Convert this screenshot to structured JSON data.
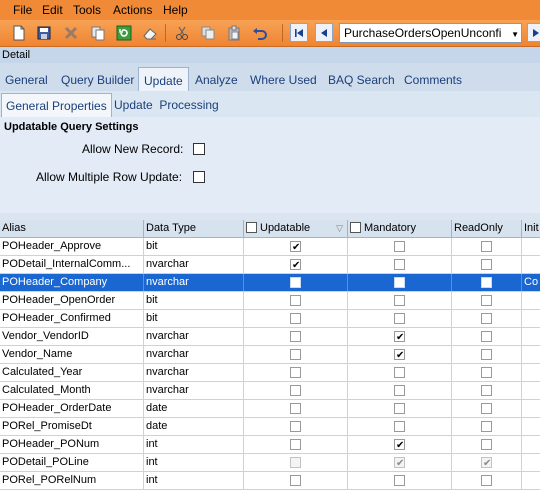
{
  "menu": {
    "items": [
      "File",
      "Edit",
      "Tools",
      "Actions",
      "Help"
    ]
  },
  "toolbar": {
    "icons": [
      "new-icon",
      "save-icon",
      "delete-icon",
      "copy-icon",
      "refresh-icon",
      "clear-icon",
      "cut-icon",
      "copy-clip-icon",
      "paste-icon",
      "undo-icon"
    ],
    "query_selector_value": "PurchaseOrdersOpenUnconfi"
  },
  "detail_label": "Detail",
  "tabs": [
    "General",
    "Query Builder",
    "Update",
    "Analyze",
    "Where Used",
    "BAQ Search",
    "Comments"
  ],
  "active_tab": "Update",
  "subtabs": [
    "General Properties",
    "Update  Processing"
  ],
  "settings": {
    "title": "Updatable Query Settings",
    "allow_new_record": "Allow New Record:",
    "allow_multiple": "Allow Multiple Row Update:"
  },
  "grid": {
    "columns": [
      "Alias",
      "Data Type",
      "Updatable",
      "Mandatory",
      "ReadOnly",
      "Init"
    ],
    "rows": [
      {
        "alias": "POHeader_Approve",
        "type": "bit",
        "upd": true,
        "mand": false,
        "ro": false,
        "init": ""
      },
      {
        "alias": "PODetail_InternalComm...",
        "type": "nvarchar",
        "upd": true,
        "mand": false,
        "ro": false,
        "init": ""
      },
      {
        "alias": "POHeader_Company",
        "type": "nvarchar",
        "upd": false,
        "mand": false,
        "ro": false,
        "init": "Co",
        "selected": true
      },
      {
        "alias": "POHeader_OpenOrder",
        "type": "bit",
        "upd": false,
        "mand": false,
        "ro": false,
        "init": ""
      },
      {
        "alias": "POHeader_Confirmed",
        "type": "bit",
        "upd": false,
        "mand": false,
        "ro": false,
        "init": ""
      },
      {
        "alias": "Vendor_VendorID",
        "type": "nvarchar",
        "upd": false,
        "mand": true,
        "ro": false,
        "init": ""
      },
      {
        "alias": "Vendor_Name",
        "type": "nvarchar",
        "upd": false,
        "mand": true,
        "ro": false,
        "init": ""
      },
      {
        "alias": "Calculated_Year",
        "type": "nvarchar",
        "upd": false,
        "mand": false,
        "ro": false,
        "init": ""
      },
      {
        "alias": "Calculated_Month",
        "type": "nvarchar",
        "upd": false,
        "mand": false,
        "ro": false,
        "init": ""
      },
      {
        "alias": "POHeader_OrderDate",
        "type": "date",
        "upd": false,
        "mand": false,
        "ro": false,
        "init": ""
      },
      {
        "alias": "PORel_PromiseDt",
        "type": "date",
        "upd": false,
        "mand": false,
        "ro": false,
        "init": ""
      },
      {
        "alias": "POHeader_PONum",
        "type": "int",
        "upd": false,
        "mand": true,
        "ro": false,
        "init": ""
      },
      {
        "alias": "PODetail_POLine",
        "type": "int",
        "upd": false,
        "mand": true,
        "ro": true,
        "init": "",
        "disabled": true
      },
      {
        "alias": "PORel_PORelNum",
        "type": "int",
        "upd": false,
        "mand": false,
        "ro": false,
        "init": ""
      }
    ]
  }
}
